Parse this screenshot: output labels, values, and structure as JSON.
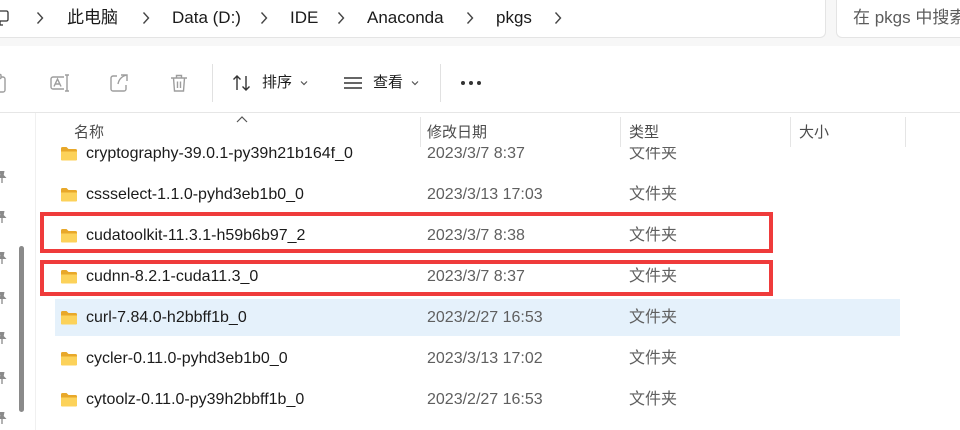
{
  "address_bar": {
    "root_icon": "computer-icon",
    "separator_icon": "chevron-right-icon",
    "breadcrumb": [
      "此电脑",
      "Data (D:)",
      "IDE",
      "Anaconda",
      "pkgs"
    ]
  },
  "search": {
    "placeholder": "在 pkgs 中搜索"
  },
  "toolbar": {
    "actions": [
      {
        "icon": "paste-icon",
        "enabled": false
      },
      {
        "icon": "rename-icon",
        "enabled": false
      },
      {
        "icon": "share-icon",
        "enabled": false
      },
      {
        "icon": "delete-icon",
        "enabled": false
      }
    ],
    "sort": {
      "label": "排序",
      "icon": "sort-icon",
      "dropdown_icon": "chevron-down-icon"
    },
    "view": {
      "label": "查看",
      "icon": "view-icon",
      "dropdown_icon": "chevron-down-icon"
    },
    "more": {
      "icon": "more-icon"
    }
  },
  "nav_pane": {
    "items": [
      {
        "icon": "pin-icon"
      },
      {
        "icon": "pin-icon"
      },
      {
        "icon": "pin-icon"
      },
      {
        "icon": "pin-icon"
      },
      {
        "icon": "pin-icon"
      },
      {
        "icon": "pin-icon"
      },
      {
        "icon": "pin-icon"
      }
    ]
  },
  "columns": {
    "name": "名称",
    "modified": "修改日期",
    "type": "类型",
    "size": "大小",
    "sort_indicator_icon": "chevron-up-icon"
  },
  "files": [
    {
      "name": "cryptography-39.0.1-py39h21b164f_0",
      "modified": "2023/3/7 8:37",
      "type": "文件夹",
      "icon": "folder-icon",
      "marked": false,
      "hovered": false
    },
    {
      "name": "cssselect-1.1.0-pyhd3eb1b0_0",
      "modified": "2023/3/13 17:03",
      "type": "文件夹",
      "icon": "folder-icon",
      "marked": false,
      "hovered": false
    },
    {
      "name": "cudatoolkit-11.3.1-h59b6b97_2",
      "modified": "2023/3/7 8:38",
      "type": "文件夹",
      "icon": "folder-icon",
      "marked": true,
      "hovered": false
    },
    {
      "name": "cudnn-8.2.1-cuda11.3_0",
      "modified": "2023/3/7 8:37",
      "type": "文件夹",
      "icon": "folder-icon",
      "marked": true,
      "hovered": false
    },
    {
      "name": "curl-7.84.0-h2bbff1b_0",
      "modified": "2023/2/27 16:53",
      "type": "文件夹",
      "icon": "folder-icon",
      "marked": false,
      "hovered": true
    },
    {
      "name": "cycler-0.11.0-pyhd3eb1b0_0",
      "modified": "2023/3/13 17:02",
      "type": "文件夹",
      "icon": "folder-icon",
      "marked": false,
      "hovered": false
    },
    {
      "name": "cytoolz-0.11.0-py39h2bbff1b_0",
      "modified": "2023/2/27 16:53",
      "type": "文件夹",
      "icon": "folder-icon",
      "marked": false,
      "hovered": false
    }
  ],
  "colors": {
    "hover_row": "#e5f1fb",
    "annotation": "#ef3b3b",
    "folder": "#fcd25a",
    "folder_back": "#e8a82a",
    "text": "#1b1b1b",
    "muted": "#5f5f5f"
  }
}
